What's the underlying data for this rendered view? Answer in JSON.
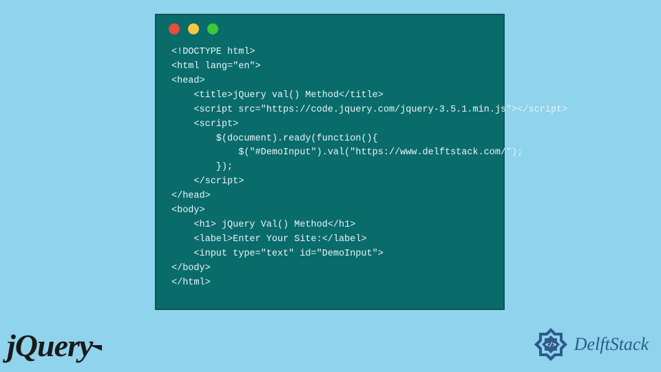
{
  "code": {
    "lines": [
      "<!DOCTYPE html>",
      "<html lang=\"en\">",
      "<head>",
      "    <title>jQuery val() Method</title>",
      "    <script src=\"https://code.jquery.com/jquery-3.5.1.min.js\"></script>",
      "    <script>",
      "        $(document).ready(function(){",
      "            $(\"#DemoInput\").val(\"https://www.delftstack.com/\");",
      "        });",
      "    </script>",
      "</head>",
      "<body>",
      "    <h1> jQuery Val() Method</h1>",
      "    <label>Enter Your Site:</label>",
      "    <input type=\"text\" id=\"DemoInput\">",
      "</body>",
      "</html>"
    ]
  },
  "logos": {
    "jquery": "jQuery",
    "delftstack": "DelftStack"
  }
}
